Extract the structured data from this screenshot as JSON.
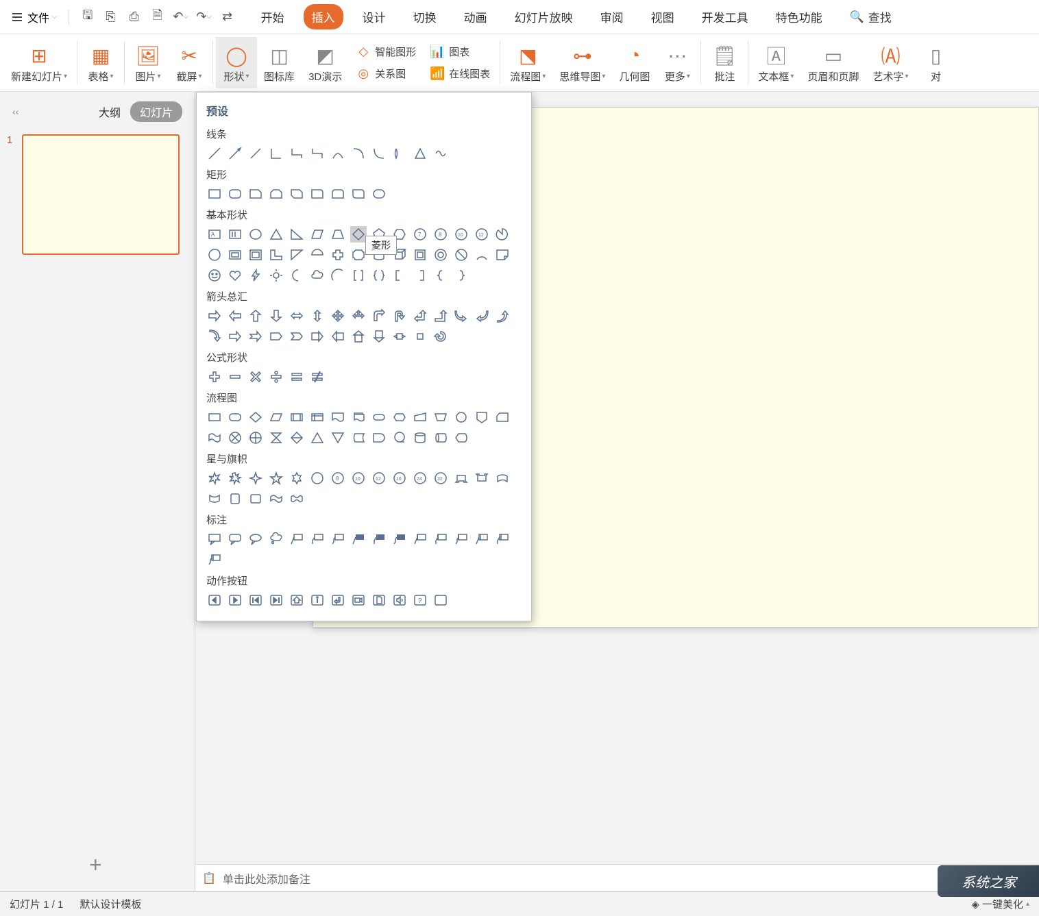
{
  "file_menu": "文件",
  "menu": {
    "start": "开始",
    "insert": "插入",
    "design": "设计",
    "transition": "切换",
    "animation": "动画",
    "slideshow": "幻灯片放映",
    "review": "审阅",
    "view": "视图",
    "devtools": "开发工具",
    "special": "特色功能"
  },
  "search": "查找",
  "ribbon": {
    "new_slide": "新建幻灯片",
    "table": "表格",
    "image": "图片",
    "screenshot": "截屏",
    "shape": "形状",
    "icon_lib": "图标库",
    "3d": "3D演示",
    "smart": "智能图形",
    "chart": "图表",
    "relation": "关系图",
    "online_chart": "在线图表",
    "flowchart": "流程图",
    "mindmap": "思维导图",
    "geometry": "几何图",
    "more": "更多",
    "comment": "批注",
    "textbox": "文本框",
    "header": "页眉和页脚",
    "wordart": "艺术字",
    "symbol": "对"
  },
  "panel": {
    "outline": "大纲",
    "slides": "幻灯片",
    "num": "1"
  },
  "shapes": {
    "preset": "预设",
    "lines": "线条",
    "rects": "矩形",
    "basic": "基本形状",
    "arrows": "箭头总汇",
    "equation": "公式形状",
    "flowchart": "流程图",
    "stars": "星与旗帜",
    "callouts": "标注",
    "actions": "动作按钮",
    "tooltip": "菱形"
  },
  "notes": "单击此处添加备注",
  "status": {
    "page": "幻灯片 1 / 1",
    "template": "默认设计模板",
    "beautify": "一键美化"
  },
  "watermark": "系统之家"
}
